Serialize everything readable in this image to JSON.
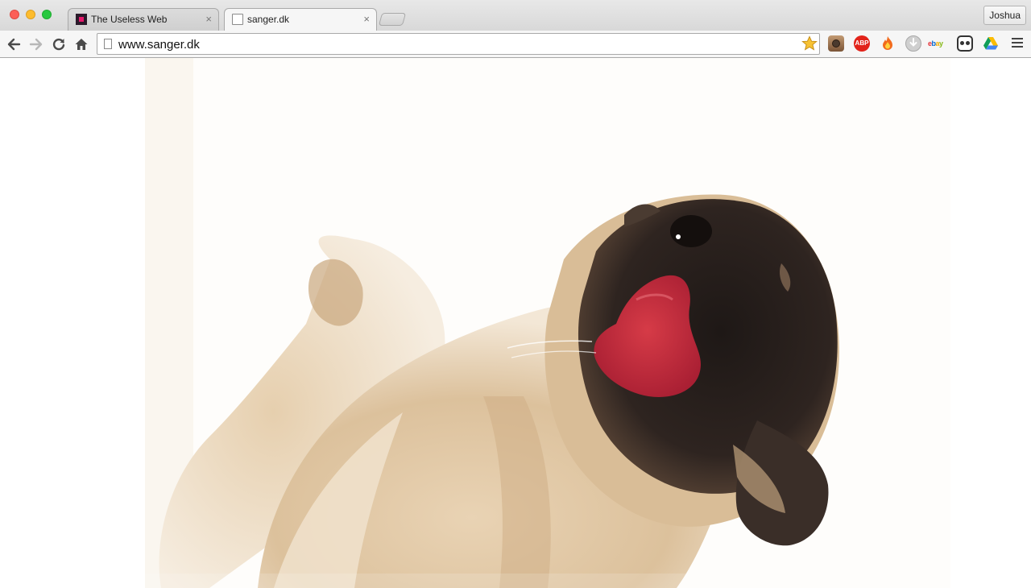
{
  "browser": {
    "tabs": [
      {
        "title": "The Useless Web",
        "favicon": "useless-web-favicon",
        "active": false
      },
      {
        "title": "sanger.dk",
        "favicon": "page-icon",
        "active": true
      }
    ],
    "close_glyph": "×",
    "profile_name": "Joshua"
  },
  "toolbar": {
    "back_icon": "←",
    "forward_icon": "→",
    "reload_icon": "↻",
    "home_icon": "⌂",
    "url": "www.sanger.dk",
    "bookmark_star": "★",
    "extensions": [
      {
        "name": "instagram-icon"
      },
      {
        "name": "adblock-plus-icon",
        "label": "ABP"
      },
      {
        "name": "fire-icon"
      },
      {
        "name": "download-icon"
      },
      {
        "name": "ebay-icon",
        "letters": [
          "e",
          "b",
          "a",
          "y"
        ]
      },
      {
        "name": "owl-icon"
      },
      {
        "name": "google-drive-icon"
      }
    ]
  },
  "page": {
    "content": "pug-licking-screen-image",
    "colors": {
      "background": "#ffffff",
      "fur": "#e2c9a6",
      "mask": "#2a2220",
      "tongue": "#c8323f"
    }
  }
}
